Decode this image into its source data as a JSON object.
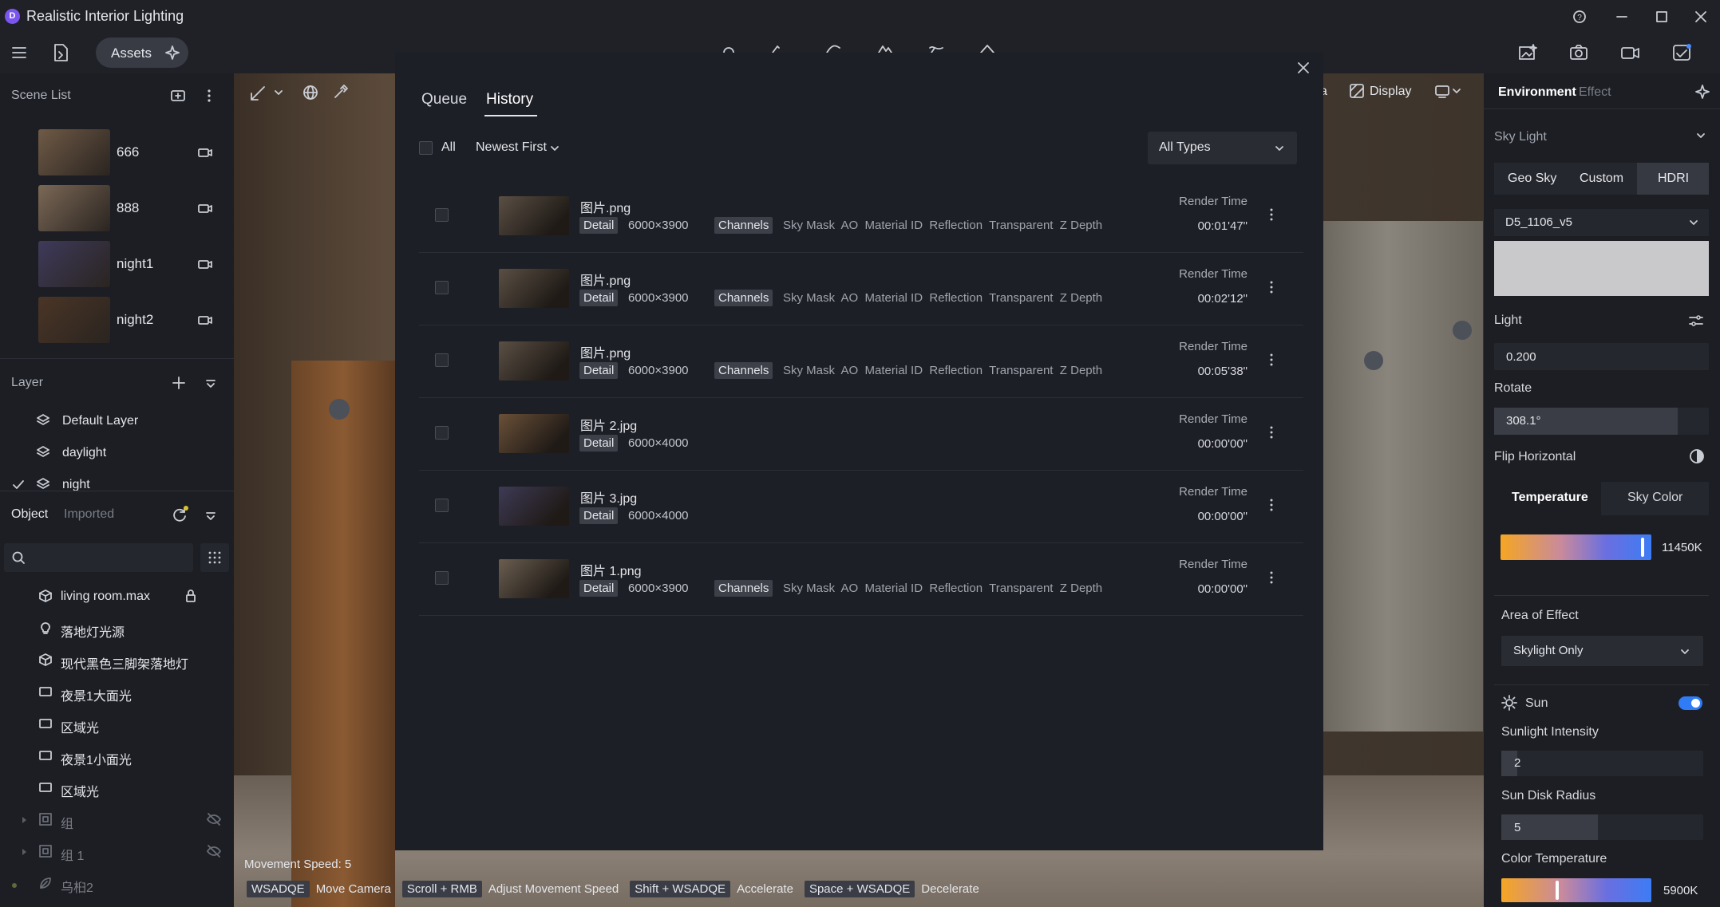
{
  "app": {
    "logo": "D",
    "title": "Realistic Interior Lighting"
  },
  "toolbar": {
    "assets_label": "Assets"
  },
  "scene_list": {
    "title": "Scene List",
    "scenes": [
      {
        "name": "666",
        "thumb": "#6f5a46"
      },
      {
        "name": "888",
        "thumb": "#7b6856"
      },
      {
        "name": "night1",
        "thumb": "#3e3a5a"
      },
      {
        "name": "night2",
        "thumb": "#4a3526"
      }
    ]
  },
  "layers": {
    "title": "Layer",
    "items": [
      {
        "name": "Default Layer"
      },
      {
        "name": "daylight"
      },
      {
        "name": "night"
      }
    ]
  },
  "objects": {
    "tab_object": "Object",
    "tab_imported": "Imported",
    "items": [
      {
        "name": "living room.max"
      },
      {
        "name": "落地灯光源"
      },
      {
        "name": "现代黑色三脚架落地灯"
      },
      {
        "name": "夜景1大面光"
      },
      {
        "name": "区域光"
      },
      {
        "name": "夜景1小面光"
      },
      {
        "name": "区域光"
      },
      {
        "name": "组"
      },
      {
        "name": "组 1"
      },
      {
        "name": "乌桕2"
      }
    ]
  },
  "viewport": {
    "top_right_label": "a",
    "display_label": "Display"
  },
  "dialog": {
    "tab_queue": "Queue",
    "tab_history": "History",
    "select_all": "All",
    "sort": "Newest First",
    "type_filter": "All Types",
    "render_time_label": "Render Time",
    "rows": [
      {
        "name": "图片.png",
        "detail": "Detail",
        "resolution": "6000×3900",
        "channels_label": "Channels",
        "channels": "Sky Mask  AO  Material ID  Reflection  Transparent  Z Depth",
        "time": "00:01'47\"",
        "thumb": "#5a4f44"
      },
      {
        "name": "图片.png",
        "detail": "Detail",
        "resolution": "6000×3900",
        "channels_label": "Channels",
        "channels": "Sky Mask  AO  Material ID  Reflection  Transparent  Z Depth",
        "time": "00:02'12\"",
        "thumb": "#5a4f44"
      },
      {
        "name": "图片.png",
        "detail": "Detail",
        "resolution": "6000×3900",
        "channels_label": "Channels",
        "channels": "Sky Mask  AO  Material ID  Reflection  Transparent  Z Depth",
        "time": "00:05'38\"",
        "thumb": "#5a4f44"
      },
      {
        "name": "图片 2.jpg",
        "detail": "Detail",
        "resolution": "6000×4000",
        "channels_label": "",
        "channels": "",
        "time": "00:00'00\"",
        "thumb": "#6a5038"
      },
      {
        "name": "图片 3.jpg",
        "detail": "Detail",
        "resolution": "6000×4000",
        "channels_label": "",
        "channels": "",
        "time": "00:00'00\"",
        "thumb": "#3e3a55"
      },
      {
        "name": "图片 1.png",
        "detail": "Detail",
        "resolution": "6000×3900",
        "channels_label": "Channels",
        "channels": "Sky Mask  AO  Material ID  Reflection  Transparent  Z Depth",
        "time": "00:00'00\"",
        "thumb": "#6b5e50"
      }
    ]
  },
  "env": {
    "tab_environment": "Environment",
    "tab_effect": "Effect",
    "sky_light": "Sky Light",
    "sky_modes": [
      "Geo Sky",
      "Custom",
      "HDRI"
    ],
    "hdri_name": "D5_1106_v5",
    "light_label": "Light",
    "light_value": "0.200",
    "rotate_label": "Rotate",
    "rotate_value": "308.1°",
    "rotate_fraction": 0.856,
    "flip_label": "Flip Horizontal",
    "temp_tab": "Temperature",
    "sky_color_tab": "Sky Color",
    "temp_value": "11450K",
    "temp_fraction": 0.94,
    "area_label": "Area of Effect",
    "area_value": "Skylight Only",
    "sun_label": "Sun",
    "sun_on": true,
    "sun_intensity_label": "Sunlight Intensity",
    "sun_intensity_value": "2",
    "sun_intensity_fraction": 0.08,
    "sun_disk_label": "Sun Disk Radius",
    "sun_disk_value": "5",
    "sun_disk_fraction": 0.48,
    "color_temp_label": "Color Temperature",
    "color_temp_value": "5900K",
    "color_temp_fraction": 0.37
  },
  "hints": {
    "speed": "Movement Speed: 5",
    "items": [
      {
        "key": "WSADQE",
        "text": "Move Camera"
      },
      {
        "key": "Scroll + RMB",
        "text": "Adjust Movement Speed"
      },
      {
        "key": "Shift + WSADQE",
        "text": "Accelerate"
      },
      {
        "key": "Space + WSADQE",
        "text": "Decelerate"
      }
    ]
  }
}
